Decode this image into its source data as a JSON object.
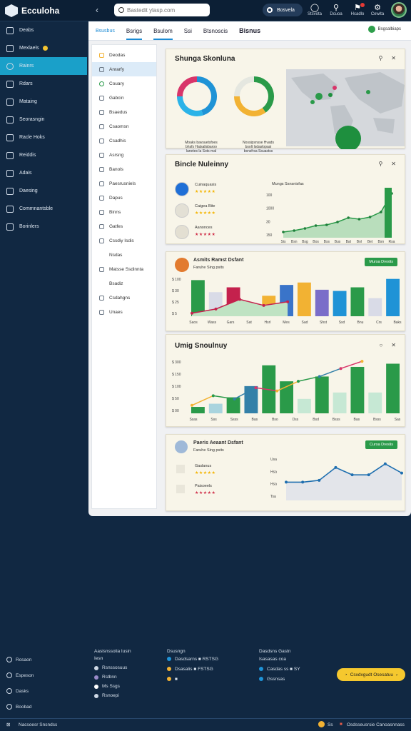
{
  "app": {
    "title": "Ecculoha"
  },
  "topbar": {
    "search_placeholder": "Bastedit ylasp.com",
    "toggle_label": "Bosvela",
    "icons": [
      {
        "name": "stats-icon",
        "label": "Stsvota",
        "glyph": "◯"
      },
      {
        "name": "bag-icon",
        "label": "Dcuoa",
        "glyph": "⚲"
      },
      {
        "name": "notify-icon",
        "label": "Hcadlo",
        "glyph": "⚑"
      },
      {
        "name": "settings-icon",
        "label": "Cewita",
        "glyph": "⚙"
      }
    ]
  },
  "sidebar": {
    "items": [
      {
        "label": "Deabs",
        "icon": "home-icon"
      },
      {
        "label": "Mexlaels",
        "icon": "box-icon"
      },
      {
        "label": "Rainrs",
        "icon": "circle-icon",
        "active": true
      },
      {
        "label": "Rdars",
        "icon": "file-icon"
      },
      {
        "label": "Mataing",
        "icon": "mail-icon"
      },
      {
        "label": "Seorasngin",
        "icon": "list-icon"
      },
      {
        "label": "Racle Hoks",
        "icon": "tag-icon"
      },
      {
        "label": "Reiddis",
        "icon": "chart-icon"
      },
      {
        "label": "Adais",
        "icon": "pin-icon"
      },
      {
        "label": "Daesing",
        "icon": "edit-icon"
      },
      {
        "label": "Commnantsble",
        "icon": "chat-icon"
      },
      {
        "label": "Borinlers",
        "icon": "people-icon"
      }
    ]
  },
  "tabs": {
    "title": "Bisnus",
    "items": [
      "Bsusbus",
      "Bsrigs",
      "Bsulom",
      "Ssi",
      "Btsnoscis"
    ],
    "right_label": "Bsgsalbiaps"
  },
  "list": {
    "items": [
      "Deodas",
      "Anrarfy",
      "Couary",
      "Gabcin",
      "Bsaedus",
      "Csaomsn",
      "Csadhis",
      "Asrsng",
      "Banols",
      "Paesrusniels",
      "Dapus",
      "Binns",
      "Gatfes",
      "Cssdiy Isdis",
      "Nsdas",
      "Matsse Ssdinnta",
      "Bsadiz",
      "Csdahgns",
      "Unaes"
    ]
  },
  "card1": {
    "title": "Shunga Skonluna",
    "donut1": {
      "values": [
        0.45,
        0.3,
        0.25
      ],
      "colors": [
        "#1f93d6",
        "#2bb3e8",
        "#d8356a"
      ],
      "caption": [
        "Moaks bavsuetsfoes",
        "bhsfs Hatsalisbaroo",
        "lanetes la Sots mal"
      ]
    },
    "donut2": {
      "values": [
        0.4,
        0.35,
        0.25
      ],
      "colors": [
        "#2a9a49",
        "#f2b233",
        "#e5e7e0"
      ],
      "caption": [
        "Nossipsnsse Hvads",
        "bsolt lsdaslopasi",
        "bsnsfrsa Ssuastss"
      ]
    }
  },
  "card2": {
    "title": "Bincle Nuleinny",
    "reviews": [
      {
        "name": "Cuinaquasis",
        "stars": "★★★★★",
        "avatar": "#1f6fd6",
        "color": "yellow"
      },
      {
        "name": "Caigea Bite",
        "stars": "★★★★★",
        "avatar": "#e3e0d5",
        "color": "yellow"
      },
      {
        "name": "Aanonces",
        "stars": "★★★★★",
        "avatar": "#e3dfd2",
        "color": "red"
      }
    ],
    "chart": {
      "type": "area",
      "title": "Mungs Ssnsnisfas",
      "ylabels": [
        "100",
        "1000",
        "30",
        "150"
      ],
      "xlabels": [
        "Sis",
        "Bsn",
        "Bsg",
        "Bos",
        "Bss",
        "Bus",
        "Bal",
        "Bol",
        "Bet",
        "Bsn",
        "Rsa"
      ],
      "values": [
        8,
        10,
        13,
        17,
        18,
        22,
        28,
        26,
        29,
        36,
        62
      ]
    }
  },
  "card3": {
    "title": "Asmits Ramst Dsfant",
    "subtitle": "Faruhe Sing psits",
    "button": "Mursa Dreslis",
    "chart": {
      "type": "bar",
      "ylabels": [
        "$ 100",
        "$ 30",
        "$ 25",
        "$ 5"
      ],
      "xlabels": [
        "Saos",
        "Wass",
        "Gars",
        "Sat",
        "Hsrl",
        "Mes",
        "Sad",
        "Shst",
        "Ssd",
        "Bnu",
        "Crs",
        "Baks"
      ],
      "line": [
        5,
        12,
        28,
        18,
        24
      ],
      "bars": [
        {
          "v": 60,
          "c": "#2a9a49"
        },
        {
          "v": 40,
          "c": "#d9dbe7"
        },
        {
          "v": 48,
          "c": "#c4214d"
        },
        {
          "v": 18,
          "c": "#3a74c9"
        },
        {
          "v": 34,
          "c": "#f2b233"
        },
        {
          "v": 52,
          "c": "#3a74c9"
        },
        {
          "v": 56,
          "c": "#f2b233"
        },
        {
          "v": 44,
          "c": "#7a6dc9"
        },
        {
          "v": 42,
          "c": "#1f93d6"
        },
        {
          "v": 48,
          "c": "#2a9a49"
        },
        {
          "v": 30,
          "c": "#d9dbe7"
        },
        {
          "v": 62,
          "c": "#1f93d6"
        }
      ]
    }
  },
  "card4": {
    "title": "Umig Snoulnuy",
    "chart": {
      "type": "bar",
      "ylabels": [
        "$ 300",
        "$ 150",
        "$ 100",
        "$ 50",
        "$ 00"
      ],
      "xlabels": [
        "Ssas",
        "Sss",
        "Ssss",
        "Bas",
        "Bso",
        "Dss",
        "Bsd",
        "Bsss",
        "Bas",
        "Bsss",
        "Sas"
      ],
      "line": [
        10,
        22,
        18,
        32,
        28,
        40,
        46,
        56,
        65
      ],
      "bars": [
        {
          "v": 8,
          "c": "#2a9a49"
        },
        {
          "v": 12,
          "c": "#a9d4de"
        },
        {
          "v": 20,
          "c": "#2a9a49"
        },
        {
          "v": 34,
          "c": "#3380a8"
        },
        {
          "v": 60,
          "c": "#2a9a49"
        },
        {
          "v": 40,
          "c": "#2a9a49"
        },
        {
          "v": 18,
          "c": "#c6e8d4"
        },
        {
          "v": 46,
          "c": "#2a9a49"
        },
        {
          "v": 26,
          "c": "#c6e8d4"
        },
        {
          "v": 58,
          "c": "#2a9a49"
        },
        {
          "v": 26,
          "c": "#c6e8d4"
        },
        {
          "v": 62,
          "c": "#2a9a49"
        }
      ]
    }
  },
  "card5": {
    "title": "Paeris Aeaant Dsfant",
    "subtitle": "Faruhe Sing psits",
    "button": "Cursa Dreslis",
    "reviews": [
      {
        "name": "Gaslanus",
        "stars": "★★★★★",
        "color": "yellow"
      },
      {
        "name": "Paisoeels",
        "stars": "★★★★★",
        "color": "red"
      }
    ],
    "chart": {
      "type": "line",
      "ylabels": [
        "Usa",
        "Hsa",
        "Hsa",
        "Tsa"
      ],
      "values": [
        20,
        20,
        22,
        36,
        28,
        28,
        40,
        30
      ]
    }
  },
  "bottom": {
    "left": [
      {
        "label": "Rosaon",
        "icon": "gear-icon"
      },
      {
        "label": "Espeson",
        "icon": "clock-icon"
      },
      {
        "label": "Dasks",
        "icon": "grid-icon"
      },
      {
        "label": "Boobad",
        "icon": "doc-icon"
      }
    ],
    "col1": {
      "title": "Aasisnssolia Iusin",
      "rows": [
        "Iesn",
        "Rsnssosuus",
        "Rstbnn",
        "Ms Ssgs",
        "Rsnoepi"
      ]
    },
    "col2": {
      "title": "Dsusngn",
      "rows": [
        "Dasdsarns ■ RSTSG",
        "Dsasalis ■ FSTSG",
        "■"
      ]
    },
    "col3": {
      "title": "Dasdsns Gastn",
      "rows": [
        "Isasasas coa",
        "Casdas ss ■ SY",
        "Gssnsas"
      ]
    },
    "cta": "Csxdxgudt Osesatuu"
  },
  "footer": {
    "left": "Nacsoesr Snsndss",
    "mid": "Ss",
    "right": "Osdsseusrsie Canoasnnass"
  }
}
